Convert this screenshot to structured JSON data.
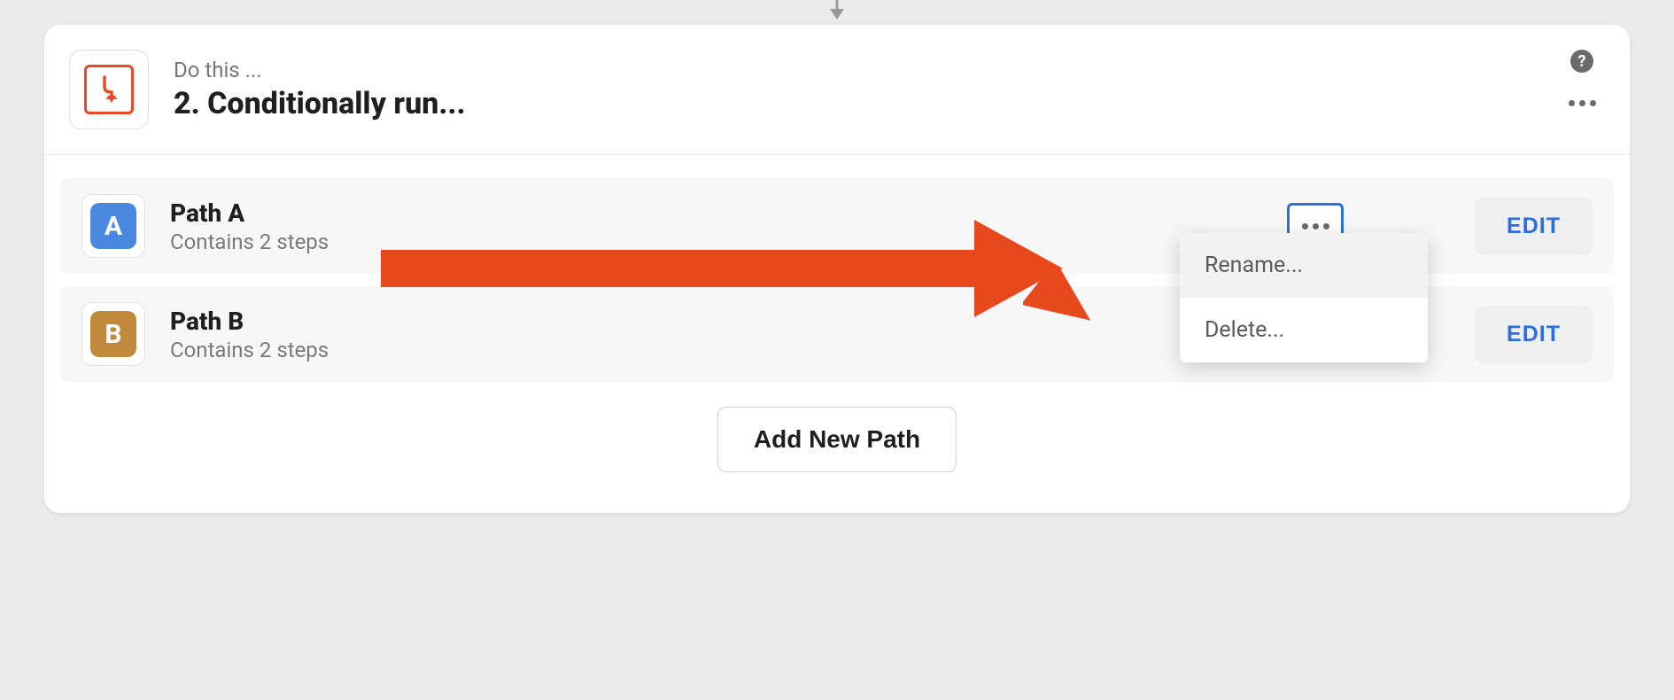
{
  "header": {
    "label": "Do this ...",
    "title": "2. Conditionally run..."
  },
  "paths": [
    {
      "badge": "A",
      "name": "Path A",
      "subtitle": "Contains 2 steps",
      "edit_label": "EDIT",
      "badge_color": "#4a88e0",
      "menu_open": true
    },
    {
      "badge": "B",
      "name": "Path B",
      "subtitle": "Contains 2 steps",
      "edit_label": "EDIT",
      "badge_color": "#c08a3a",
      "menu_open": false
    }
  ],
  "dropdown": {
    "rename": "Rename...",
    "delete": "Delete..."
  },
  "buttons": {
    "add_path": "Add New Path"
  },
  "colors": {
    "accent_orange": "#e84a27",
    "accent_blue": "#2a6ee0"
  }
}
